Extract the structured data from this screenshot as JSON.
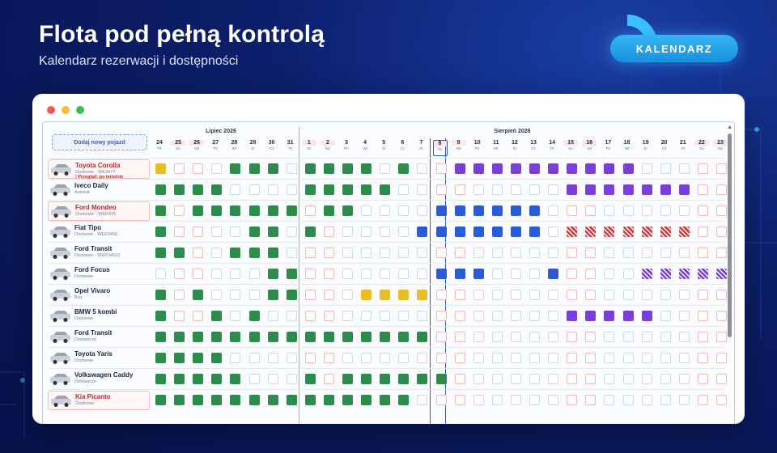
{
  "hero": {
    "title": "Flota pod pełną kontrolą",
    "subtitle": "Kalendarz rezerwacji i dostępności",
    "cta": "KALENDARZ"
  },
  "colors": {
    "green": "#2e8b4c",
    "blue": "#2c5bd6",
    "purple": "#7a3fd8",
    "yellow": "#e7bd2a",
    "red_striped": "#d73a3a",
    "alert_text": "#d0232a"
  },
  "app": {
    "add_vehicle": "Dodaj nowy pojazd",
    "months": [
      "Lipiec 2026",
      "Sierpień 2026"
    ],
    "days": [
      {
        "n": "24",
        "d": "Pt"
      },
      {
        "n": "25",
        "d": "So"
      },
      {
        "n": "26",
        "d": "Nd"
      },
      {
        "n": "27",
        "d": "Pn"
      },
      {
        "n": "28",
        "d": "Wt"
      },
      {
        "n": "29",
        "d": "Śr"
      },
      {
        "n": "30",
        "d": "Cz"
      },
      {
        "n": "31",
        "d": "Pt"
      },
      {
        "n": "1",
        "d": "So"
      },
      {
        "n": "2",
        "d": "Nd"
      },
      {
        "n": "3",
        "d": "Pn"
      },
      {
        "n": "4",
        "d": "Wt"
      },
      {
        "n": "5",
        "d": "Śr"
      },
      {
        "n": "6",
        "d": "Cz"
      },
      {
        "n": "7",
        "d": "Pt"
      },
      {
        "n": "8",
        "d": "So"
      },
      {
        "n": "9",
        "d": "Nd"
      },
      {
        "n": "10",
        "d": "Pn"
      },
      {
        "n": "11",
        "d": "Wt"
      },
      {
        "n": "12",
        "d": "Śr"
      },
      {
        "n": "13",
        "d": "Cz"
      },
      {
        "n": "14",
        "d": "Pt"
      },
      {
        "n": "15",
        "d": "So"
      },
      {
        "n": "16",
        "d": "Nd"
      },
      {
        "n": "17",
        "d": "Pn"
      },
      {
        "n": "18",
        "d": "Wt"
      },
      {
        "n": "19",
        "d": "Śr"
      },
      {
        "n": "20",
        "d": "Cz"
      },
      {
        "n": "21",
        "d": "Pt"
      },
      {
        "n": "22",
        "d": "So"
      },
      {
        "n": "23",
        "d": "Nd"
      }
    ],
    "today_index": 15,
    "vehicles": [
      {
        "name": "Toyota Corolla",
        "sub": "Osobowe - WE3477",
        "warn": "! Przegląd: po terminie",
        "alert": true,
        "cells": "y--.ggg.hggg.g..pppppppppp.."
      },
      {
        "name": "Iveco Daily",
        "sub": "Autokat",
        "warn": "",
        "alert": false,
        "cells": "gggg....ggggg.........ppppppp.."
      },
      {
        "name": "Ford Mondeo",
        "sub": "Osobowe - WER435",
        "warn": "",
        "alert": true,
        "cells": "g.gggggg.gg....bbbbbb.........."
      },
      {
        "name": "Fiat Tipo",
        "sub": "Osobowe - WER3456",
        "warn": "",
        "alert": false,
        "cells": "g....gg.g.....bbbbbbb.rrrrrrr.."
      },
      {
        "name": "Ford Transit",
        "sub": "Osobowe - WER34523",
        "warn": "",
        "alert": false,
        "cells": "gg..ggg........................"
      },
      {
        "name": "Ford Focus",
        "sub": "Osobowe",
        "warn": "",
        "alert": false,
        "cells": "......gg.......bbb...b....sssss..."
      },
      {
        "name": "Opel Vivaro",
        "sub": "Bus",
        "warn": "",
        "alert": false,
        "cells": "g.g...gg...yyyy................"
      },
      {
        "name": "BMW 5 kombi",
        "sub": "Osobowe",
        "warn": "",
        "alert": false,
        "cells": "g..g.g................ppppp....."
      },
      {
        "name": "Ford Transit",
        "sub": "Dostawcze",
        "warn": "",
        "alert": false,
        "cells": "ggggggggggggggg................"
      },
      {
        "name": "Toyota Yaris",
        "sub": "Osobowe",
        "warn": "",
        "alert": false,
        "cells": "gggg..........................."
      },
      {
        "name": "Volkswagen Caddy",
        "sub": "Dostawcze",
        "warn": "",
        "alert": false,
        "cells": "ggggg...g.gggggg..............."
      },
      {
        "name": "Kia Picanto",
        "sub": "Osobowe",
        "warn": "",
        "alert": true,
        "cells": "gggggggggggggg................."
      }
    ]
  }
}
